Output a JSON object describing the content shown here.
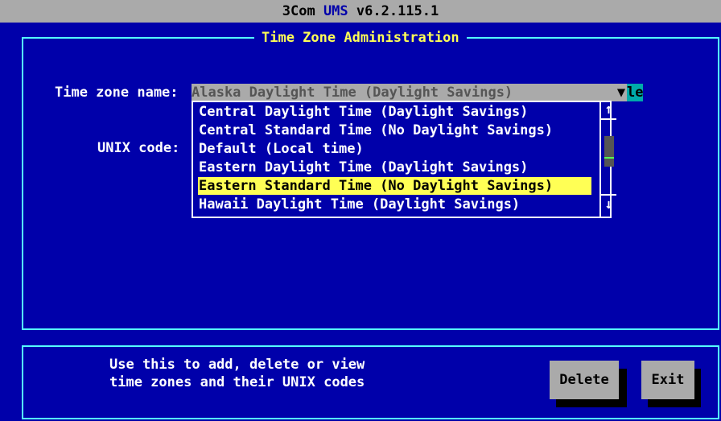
{
  "app": {
    "title_prefix": "3Com ",
    "title_brand": "UMS",
    "title_version": " v6.2.115.1"
  },
  "dialog": {
    "title": "Time Zone Administration"
  },
  "form": {
    "tz_label": "Time zone name:",
    "tz_value": "Alaska Daylight Time (Daylight Savings)",
    "tz_dropdown_arrow": "▼",
    "tz_overflow_text": "le",
    "unix_label": "UNIX code:"
  },
  "dropdown": {
    "items": [
      "Central Daylight Time (Daylight Savings)",
      "Central Standard Time (No Daylight Savings)",
      "Default (Local time)",
      "Eastern Daylight Time (Daylight Savings)",
      "Eastern Standard Time (No Daylight Savings)",
      "Hawaii Daylight Time (Daylight Savings)"
    ],
    "selected_index": 4,
    "scroll_up": "↑",
    "scroll_down": "↓"
  },
  "help": {
    "line1": "Use this to add, delete or view",
    "line2": "time zones and their UNIX codes"
  },
  "buttons": {
    "delete": "Delete",
    "exit": "Exit"
  },
  "colors": {
    "background": "#0000aa",
    "frame": "#55ffff",
    "title_text": "#ffff55",
    "selection": "#ffff55",
    "field_bg": "#aaaaaa",
    "overflow_bg": "#00aaaa"
  }
}
